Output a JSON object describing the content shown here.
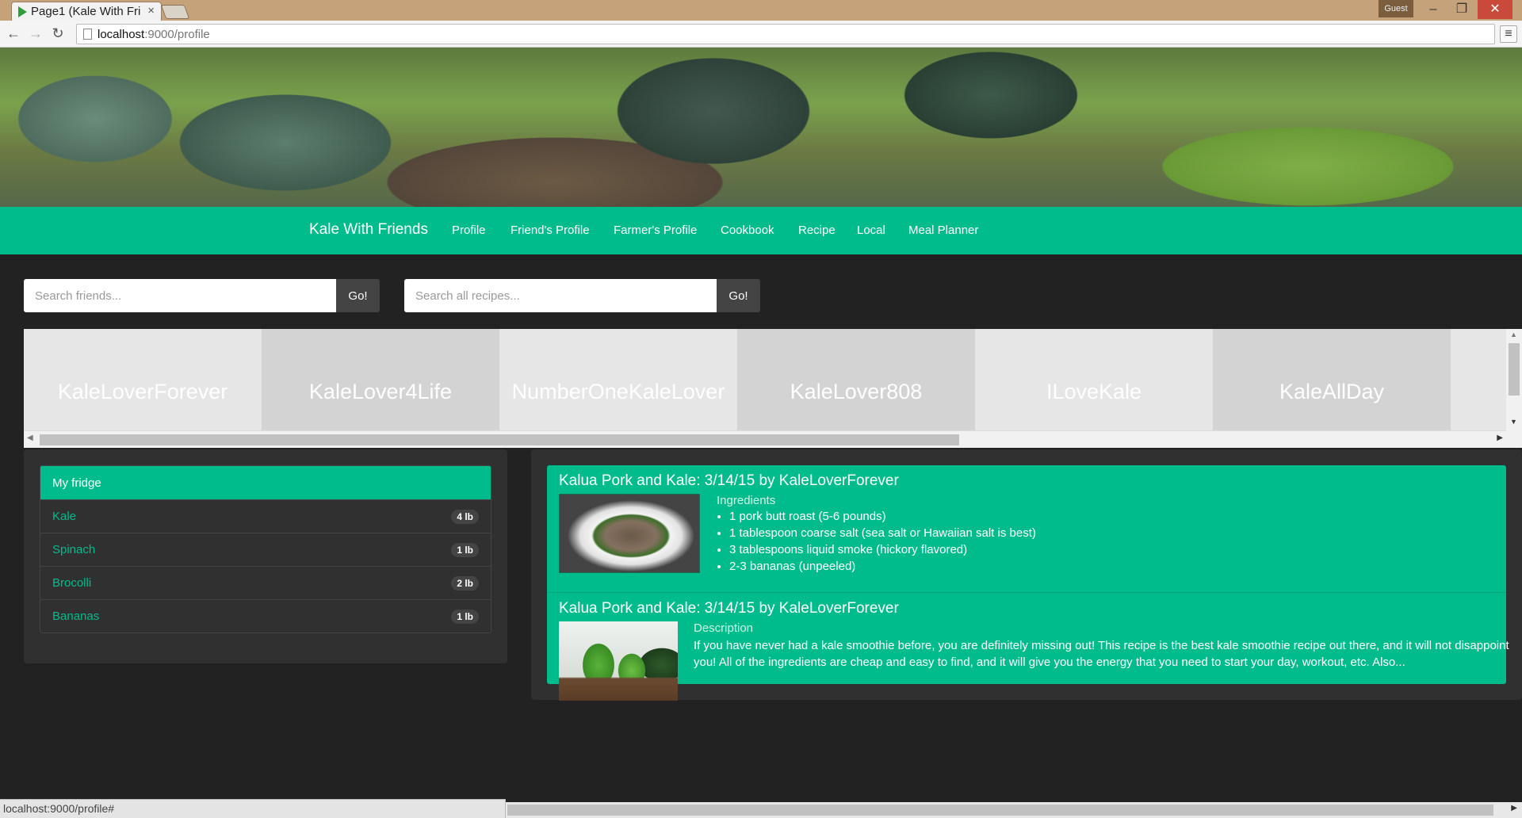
{
  "browser": {
    "tab_title": "Page1 (Kale With Fri",
    "tab_close": "×",
    "profile_label": "Guest",
    "win_minimize": "–",
    "win_restore": "❐",
    "win_close": "✕",
    "url_host": "localhost",
    "url_path": ":9000/profile",
    "back_icon": "←",
    "forward_icon": "→",
    "reload_icon": "↻",
    "menu_icon": "≡",
    "status_url": "localhost:9000/profile#"
  },
  "navbar": {
    "brand": "Kale With Friends",
    "links": [
      "Profile",
      "Friend's Profile",
      "Farmer's Profile",
      "Cookbook",
      "Recipe",
      "Local",
      "Meal Planner"
    ]
  },
  "search": {
    "friends_placeholder": "Search friends...",
    "recipes_placeholder": "Search all recipes...",
    "go_label": "Go!"
  },
  "friends": [
    "KaleLoverForever",
    "KaleLover4Life",
    "NumberOneKaleLover",
    "KaleLover808",
    "ILoveKale",
    "KaleAllDay"
  ],
  "fridge": {
    "title": "My fridge",
    "items": [
      {
        "name": "Kale",
        "qty": "4 lb"
      },
      {
        "name": "Spinach",
        "qty": "1 lb"
      },
      {
        "name": "Brocolli",
        "qty": "2 lb"
      },
      {
        "name": "Bananas",
        "qty": "1 lb"
      }
    ]
  },
  "recipes": [
    {
      "title": "Kalua Pork and Kale: 3/14/15 by KaleLoverForever",
      "section": "Ingredients",
      "ingredients": [
        "1 pork butt roast (5-6 pounds)",
        "1 tablespoon coarse salt (sea salt or Hawaiian salt is best)",
        "3 tablespoons liquid smoke (hickory flavored)",
        "2-3 bananas (unpeeled)"
      ]
    },
    {
      "title": "Kalua Pork and Kale: 3/14/15 by KaleLoverForever",
      "section": "Description",
      "description": "If you have never had a kale smoothie before, you are definitely missing out! This recipe is the best kale smoothie recipe out there, and it will not disappoint you! All of the ingredients are cheap and easy to find, and it will give you the energy that you need to start your day, workout, etc. Also..."
    }
  ],
  "scroll_arrows": {
    "left": "◀",
    "right": "▶",
    "up": "▲",
    "down": "▼"
  }
}
